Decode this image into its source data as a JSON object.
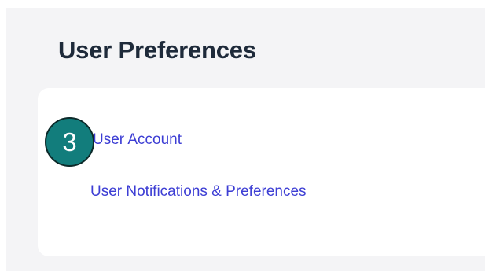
{
  "page": {
    "title": "User Preferences"
  },
  "links": {
    "user_account": "User Account",
    "user_notifications": "User Notifications & Preferences"
  },
  "step_badge": {
    "number": "3"
  },
  "colors": {
    "background": "#f4f4f6",
    "card": "#ffffff",
    "title": "#1e2a3a",
    "link": "#3d3ed4",
    "badge": "#127d7c"
  }
}
